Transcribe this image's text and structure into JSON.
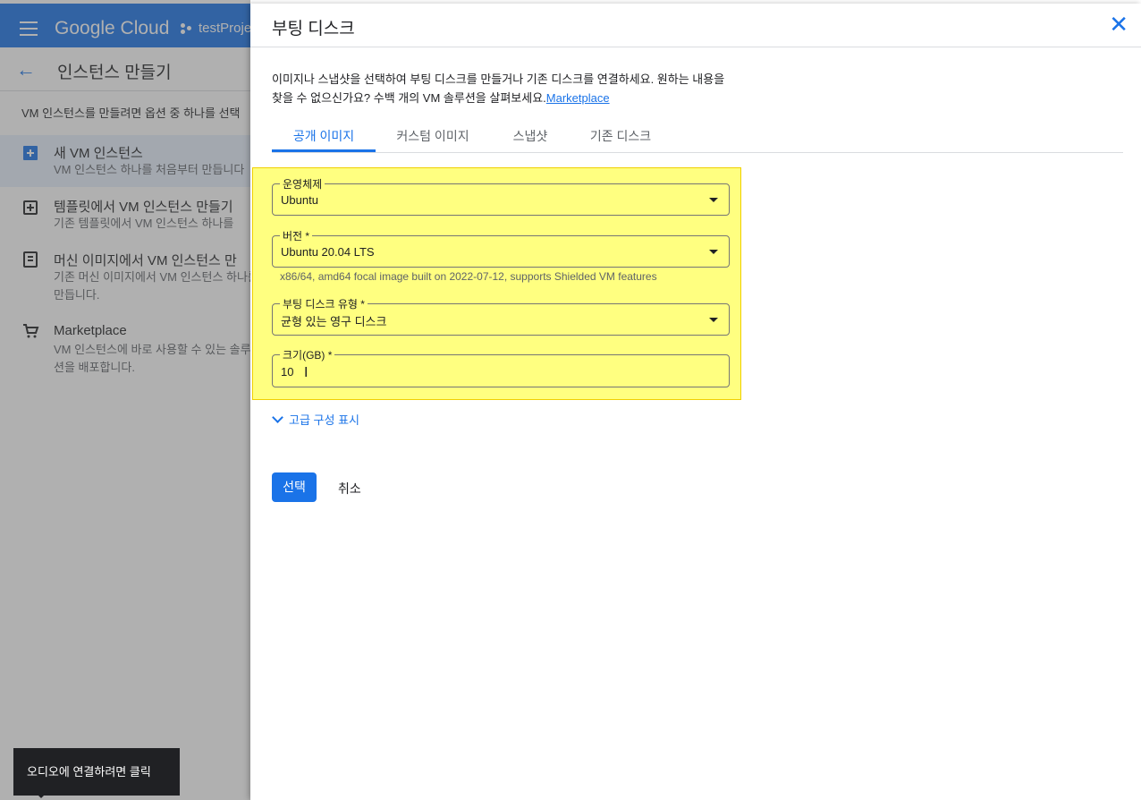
{
  "topbar": {
    "logo": "Google Cloud",
    "project": "testProje"
  },
  "background": {
    "title": "인스턴스 만들기",
    "description": "VM 인스턴스를 만들려면 옵션 중 하나를 선택",
    "options": [
      {
        "title": "새 VM 인스턴스",
        "subtitle": "VM 인스턴스 하나를 처음부터 만듭니다"
      },
      {
        "title": "템플릿에서 VM 인스턴스 만들기",
        "subtitle": "기존 템플릿에서 VM 인스턴스 하나를"
      },
      {
        "title": "머신 이미지에서 VM 인스턴스 만",
        "subtitle": "기존 머신 이미지에서 VM 인스턴스 하나를 만듭니다."
      },
      {
        "title": "Marketplace",
        "subtitle": "VM 인스턴스에 바로 사용할 수 있는 솔루션을 배포합니다."
      }
    ]
  },
  "dialog": {
    "title": "부팅 디스크",
    "description": "이미지나 스냅샷을 선택하여 부팅 디스크를 만들거나 기존 디스크를 연결하세요. 원하는 내용을 찾을 수 없으신가요? 수백 개의 VM 솔루션을 살펴보세요.",
    "marketplace_link": "Marketplace",
    "tabs": [
      "공개 이미지",
      "커스텀 이미지",
      "스냅샷",
      "기존 디스크"
    ],
    "fields": {
      "os": {
        "label": "운영체제",
        "value": "Ubuntu"
      },
      "version": {
        "label": "버전 *",
        "value": "Ubuntu 20.04 LTS",
        "hint": "x86/64, amd64 focal image built on 2022-07-12, supports Shielded VM features"
      },
      "disk_type": {
        "label": "부팅 디스크 유형 *",
        "value": "균형 있는 영구 디스크"
      },
      "size": {
        "label": "크기(GB) *",
        "value": "10"
      }
    },
    "advanced_label": "고급 구성 표시",
    "select_label": "선택",
    "cancel_label": "취소"
  },
  "tooltip": {
    "text": "오디오에 연결하려면 클릭"
  },
  "colors": {
    "accent": "#1a73e8",
    "highlight": "#ffff80"
  }
}
